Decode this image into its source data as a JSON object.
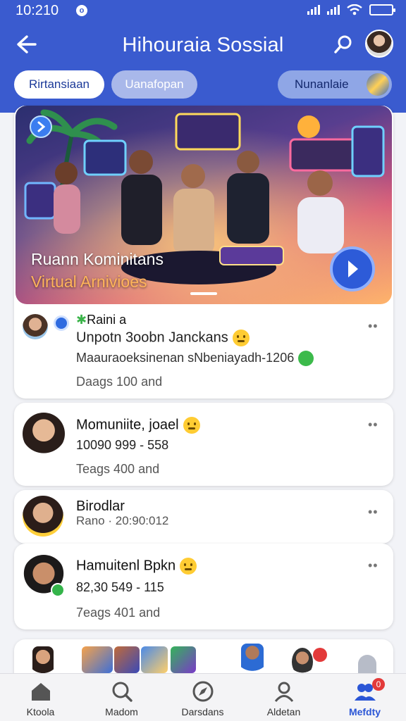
{
  "status": {
    "time": "10:210",
    "dot": "o"
  },
  "header": {
    "title": "Hihouraia Sossial",
    "back_icon": "back-arrow-icon",
    "search_icon": "search-icon"
  },
  "chips": [
    {
      "label": "Rirtansiaan"
    },
    {
      "label": "Uanafopan"
    },
    {
      "label": "Nunanlaie"
    }
  ],
  "hero": {
    "line1": "Ruann Kominitans",
    "line2": "Virtual Arnivioes"
  },
  "posts": [
    {
      "author": "Raini a",
      "title": "Unpotn 3oobn Janckans",
      "subtitle": "Maauraoeksinenan sNbeniayadh-1206",
      "meta": "Daags 100 and"
    },
    {
      "title": "Momuniite, joael",
      "subtitle": "10090 999 - 558",
      "meta": "Teags 400 and"
    },
    {
      "title": "Birodlar",
      "subtitle": "Rano · 20:90:012"
    },
    {
      "title": "Hamuitenl Bpkn",
      "subtitle": "82,30 549 - 115",
      "meta": "7eags 401 and"
    }
  ],
  "nav": [
    {
      "label": "Ktoola",
      "icon": "home-icon"
    },
    {
      "label": "Madom",
      "icon": "search-icon"
    },
    {
      "label": "Darsdans",
      "icon": "explore-icon"
    },
    {
      "label": "Aldetan",
      "icon": "profile-icon"
    },
    {
      "label": "Mefdty",
      "icon": "community-icon",
      "active": true,
      "badge": "0"
    }
  ],
  "colors": {
    "brand": "#3a5bcf",
    "accent": "#2b56d6"
  }
}
